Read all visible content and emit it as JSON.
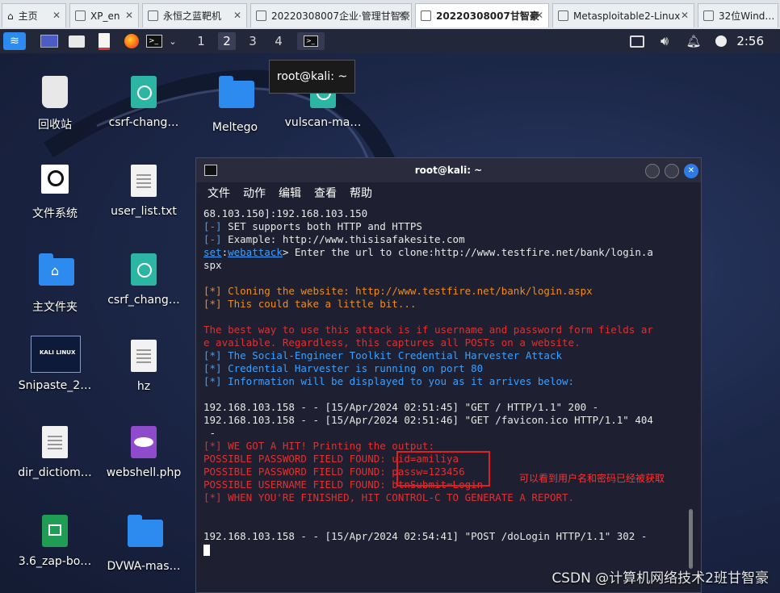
{
  "browser_tabs": [
    {
      "label": "主页",
      "active": false
    },
    {
      "label": "XP_en",
      "active": false
    },
    {
      "label": "永恒之蓝靶机",
      "active": false
    },
    {
      "label": "20220308007企业·管理甘智豪",
      "active": false
    },
    {
      "label": "20220308007甘智豪",
      "active": true
    },
    {
      "label": "Metasploitable2-Linux",
      "active": false
    },
    {
      "label": "32位Wind…",
      "active": false
    }
  ],
  "panel": {
    "workspaces": [
      "1",
      "2",
      "3",
      "4"
    ],
    "clock": "2:56"
  },
  "tooltip": "root@kali: ~",
  "desktop_icons": [
    {
      "label": "回收站",
      "icon": "trash-icon"
    },
    {
      "label": "csrf-chang…",
      "icon": "html-file-icon"
    },
    {
      "label": "Meltego",
      "icon": "folder-icon"
    },
    {
      "label": "vulscan-ma…",
      "icon": "html-file-icon"
    },
    {
      "label": "文件系统",
      "icon": "drive-icon"
    },
    {
      "label": "user_list.txt",
      "icon": "text-file-icon"
    },
    {
      "label": "主文件夹",
      "icon": "home-folder-icon"
    },
    {
      "label": "csrf_chang…",
      "icon": "html-file-icon"
    },
    {
      "label": "Snipaste_2…",
      "icon": "image-file-icon"
    },
    {
      "label": "hz",
      "icon": "text-file-icon"
    },
    {
      "label": "dir_dictiom…",
      "icon": "text-file-icon"
    },
    {
      "label": "webshell.php",
      "icon": "php-file-icon"
    },
    {
      "label": "3.6_zap-bo…",
      "icon": "spreadsheet-icon"
    },
    {
      "label": "DVWA-mas…",
      "icon": "folder-icon"
    }
  ],
  "snipaste_thumb_text": "KALI LINUX",
  "terminal": {
    "title": "root@kali: ~",
    "menu": [
      "文件",
      "动作",
      "编辑",
      "查看",
      "帮助"
    ],
    "lines": [
      [
        {
          "t": "68.103.150]:192.168.103.150",
          "c": ""
        }
      ],
      [
        {
          "t": "[-]",
          "c": "blu"
        },
        {
          "t": " SET supports both HTTP and HTTPS",
          "c": ""
        }
      ],
      [
        {
          "t": "[-]",
          "c": "blu"
        },
        {
          "t": " Example: http://www.thisisafakesite.com",
          "c": ""
        }
      ],
      [
        {
          "t": "set",
          "c": "und"
        },
        {
          "t": ":",
          "c": ""
        },
        {
          "t": "webattack",
          "c": "und"
        },
        {
          "t": "> Enter the url to clone:http://www.testfire.net/bank/login.a",
          "c": ""
        }
      ],
      [
        {
          "t": "spx",
          "c": ""
        }
      ],
      [
        {
          "t": "",
          "c": ""
        }
      ],
      [
        {
          "t": "[*] Cloning the website: http://www.testfire.net/bank/login.aspx",
          "c": "org"
        }
      ],
      [
        {
          "t": "[*] This could take a little bit...",
          "c": "org"
        }
      ],
      [
        {
          "t": "",
          "c": ""
        }
      ],
      [
        {
          "t": "The best way to use this attack is if username and password form fields ar",
          "c": "red"
        }
      ],
      [
        {
          "t": "e available. Regardless, this captures all POSTs on a website.",
          "c": "red"
        }
      ],
      [
        {
          "t": "[*] The Social-Engineer Toolkit Credential Harvester Attack",
          "c": "blu"
        }
      ],
      [
        {
          "t": "[*] Credential Harvester is running on port 80",
          "c": "blu"
        }
      ],
      [
        {
          "t": "[*] Information will be displayed to you as it arrives below:",
          "c": "blu"
        }
      ],
      [
        {
          "t": "",
          "c": ""
        }
      ],
      [
        {
          "t": "192.168.103.158 - - [15/Apr/2024 02:51:45] \"GET / HTTP/1.1\" 200 -",
          "c": ""
        }
      ],
      [
        {
          "t": "192.168.103.158 - - [15/Apr/2024 02:51:46] \"GET /favicon.ico HTTP/1.1\" 404",
          "c": ""
        }
      ],
      [
        {
          "t": " -",
          "c": ""
        }
      ],
      [
        {
          "t": "[*] WE GOT A HIT! Printing the output:",
          "c": "red"
        }
      ],
      [
        {
          "t": "POSSIBLE PASSWORD FIELD FOUND: uid=amiliya",
          "c": "red"
        }
      ],
      [
        {
          "t": "POSSIBLE PASSWORD FIELD FOUND: passw=123456",
          "c": "red"
        }
      ],
      [
        {
          "t": "POSSIBLE USERNAME FIELD FOUND: btnSubmit=Login",
          "c": "red"
        }
      ],
      [
        {
          "t": "[*] WHEN YOU'RE FINISHED, HIT CONTROL-C TO GENERATE A REPORT.",
          "c": "red"
        }
      ],
      [
        {
          "t": "",
          "c": ""
        }
      ],
      [
        {
          "t": "",
          "c": ""
        }
      ],
      [
        {
          "t": "192.168.103.158 - - [15/Apr/2024 02:54:41] \"POST /doLogin HTTP/1.1\" 302 -",
          "c": ""
        }
      ]
    ]
  },
  "annotation": "可以看到用户名和密码已经被获取",
  "watermark": "CSDN @计算机网络技术2班甘智豪",
  "colors": {
    "panel_bg": "#23273a",
    "terminal_bg": "#1e2031",
    "highlight_box": "#e02020",
    "kali_blue": "#2d8bf0"
  }
}
